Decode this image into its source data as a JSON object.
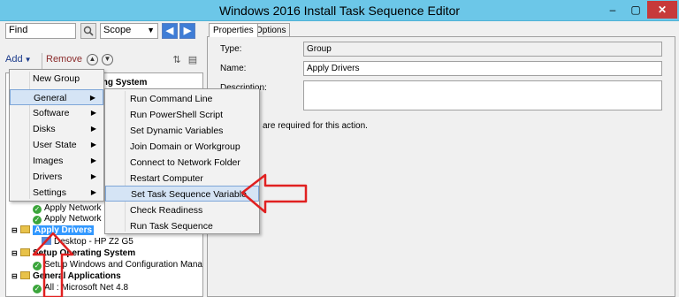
{
  "window": {
    "title": "Windows 2016 Install Task Sequence Editor",
    "min_label": "‒",
    "max_label": "▢",
    "close_label": "✕"
  },
  "search": {
    "value": "Find",
    "scope_value": "Scope",
    "find_icon": "magnifier-icon",
    "back_icon": "arrow-left-icon",
    "forward_icon": "arrow-right-icon"
  },
  "toolbar": {
    "add_label": "Add",
    "remove_label": "Remove"
  },
  "tree": {
    "partial_header": "ing System",
    "rows": [
      {
        "label": "Apply Network"
      },
      {
        "label": "Apply Network"
      },
      {
        "label": "Apply Drivers"
      },
      {
        "label": "Desktop - HP Z2 G5"
      },
      {
        "label": "Setup Operating System"
      },
      {
        "label": "Setup Windows and Configuration Manager"
      },
      {
        "label": "General Applications"
      },
      {
        "label": "All : Microsoft Net 4.8"
      }
    ]
  },
  "tabs": {
    "properties": "Properties",
    "options": "Options"
  },
  "properties": {
    "type_label": "Type:",
    "type_value": "Group",
    "name_label": "Name:",
    "name_value": "Apply Drivers",
    "description_label": "Description:",
    "description_value": "",
    "note_text": "are required  for this action."
  },
  "add_menu": {
    "items": [
      {
        "label": "New Group",
        "has_sub": false
      },
      {
        "label": "General",
        "has_sub": true
      },
      {
        "label": "Software",
        "has_sub": true
      },
      {
        "label": "Disks",
        "has_sub": true
      },
      {
        "label": "User State",
        "has_sub": true
      },
      {
        "label": "Images",
        "has_sub": true
      },
      {
        "label": "Drivers",
        "has_sub": true
      },
      {
        "label": "Settings",
        "has_sub": true
      }
    ]
  },
  "general_menu": {
    "items": [
      {
        "label": "Run Command Line"
      },
      {
        "label": "Run PowerShell Script"
      },
      {
        "label": "Set Dynamic Variables"
      },
      {
        "label": "Join Domain or Workgroup"
      },
      {
        "label": "Connect to Network Folder"
      },
      {
        "label": "Restart Computer"
      },
      {
        "label": "Set Task Sequence Variable"
      },
      {
        "label": "Check Readiness"
      },
      {
        "label": "Run Task Sequence"
      }
    ]
  },
  "colors": {
    "titlebar": "#6cc7e8",
    "annotation_arrow": "#e02020",
    "selection": "#3399ff",
    "menu_highlight": "#d5e4f5"
  }
}
